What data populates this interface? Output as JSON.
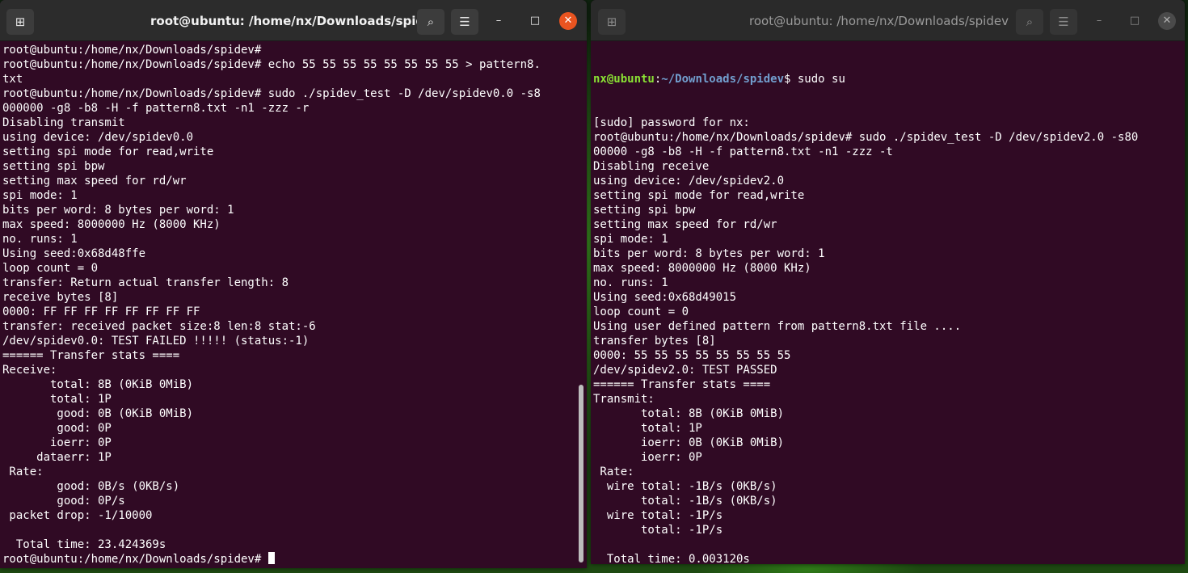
{
  "left_window": {
    "title": "root@ubuntu: /home/nx/Downloads/spidev",
    "prompt": "root@ubuntu:/home/nx/Downloads/spidev# ",
    "lines": [
      "root@ubuntu:/home/nx/Downloads/spidev#",
      "root@ubuntu:/home/nx/Downloads/spidev# echo 55 55 55 55 55 55 55 55 > pattern8.",
      "txt",
      "root@ubuntu:/home/nx/Downloads/spidev# sudo ./spidev_test -D /dev/spidev0.0 -s8",
      "000000 -g8 -b8 -H -f pattern8.txt -n1 -zzz -r",
      "Disabling transmit",
      "using device: /dev/spidev0.0",
      "setting spi mode for read,write",
      "setting spi bpw",
      "setting max speed for rd/wr",
      "spi mode: 1",
      "bits per word: 8 bytes per word: 1",
      "max speed: 8000000 Hz (8000 KHz)",
      "no. runs: 1",
      "Using seed:0x68d48ffe",
      "loop count = 0",
      "transfer: Return actual transfer length: 8",
      "receive bytes [8]",
      "0000: FF FF FF FF FF FF FF FF",
      "transfer: received packet size:8 len:8 stat:-6",
      "/dev/spidev0.0: TEST FAILED !!!!! (status:-1)",
      "====== Transfer stats ====",
      "Receive:",
      "       total: 8B (0KiB 0MiB)",
      "       total: 1P",
      "        good: 0B (0KiB 0MiB)",
      "        good: 0P",
      "       ioerr: 0P",
      "     dataerr: 1P",
      " Rate:",
      "        good: 0B/s (0KB/s)",
      "        good: 0P/s",
      " packet drop: -1/10000",
      "",
      "  Total time: 23.424369s"
    ]
  },
  "right_window": {
    "title": "root@ubuntu: /home/nx/Downloads/spidev",
    "first_line": {
      "user": "nx@ubuntu",
      "sep": ":",
      "path": "~/Downloads/spidev",
      "cmd": "$ sudo su"
    },
    "prompt": "root@ubuntu:/home/nx/Downloads/spidev# ",
    "lines": [
      "[sudo] password for nx:",
      "root@ubuntu:/home/nx/Downloads/spidev# sudo ./spidev_test -D /dev/spidev2.0 -s80",
      "00000 -g8 -b8 -H -f pattern8.txt -n1 -zzz -t",
      "Disabling receive",
      "using device: /dev/spidev2.0",
      "setting spi mode for read,write",
      "setting spi bpw",
      "setting max speed for rd/wr",
      "spi mode: 1",
      "bits per word: 8 bytes per word: 1",
      "max speed: 8000000 Hz (8000 KHz)",
      "no. runs: 1",
      "Using seed:0x68d49015",
      "loop count = 0",
      "Using user defined pattern from pattern8.txt file ....",
      "transfer bytes [8]",
      "0000: 55 55 55 55 55 55 55 55",
      "/dev/spidev2.0: TEST PASSED",
      "====== Transfer stats ====",
      "Transmit:",
      "       total: 8B (0KiB 0MiB)",
      "       total: 1P",
      "       ioerr: 0B (0KiB 0MiB)",
      "       ioerr: 0P",
      " Rate:",
      "  wire total: -1B/s (0KB/s)",
      "       total: -1B/s (0KB/s)",
      "  wire total: -1P/s",
      "       total: -1P/s",
      "",
      "  Total time: 0.003120s"
    ]
  },
  "icons": {
    "new_tab": "⊞",
    "search": "⌕",
    "menu": "☰",
    "minimize": "–",
    "maximize": "□",
    "close": "✕"
  },
  "colors": {
    "terminal_bg": "#300a24",
    "titlebar": "#2c2c2c",
    "close_active": "#e95420",
    "prompt_user": "#8ae234",
    "prompt_path": "#729fcf"
  }
}
